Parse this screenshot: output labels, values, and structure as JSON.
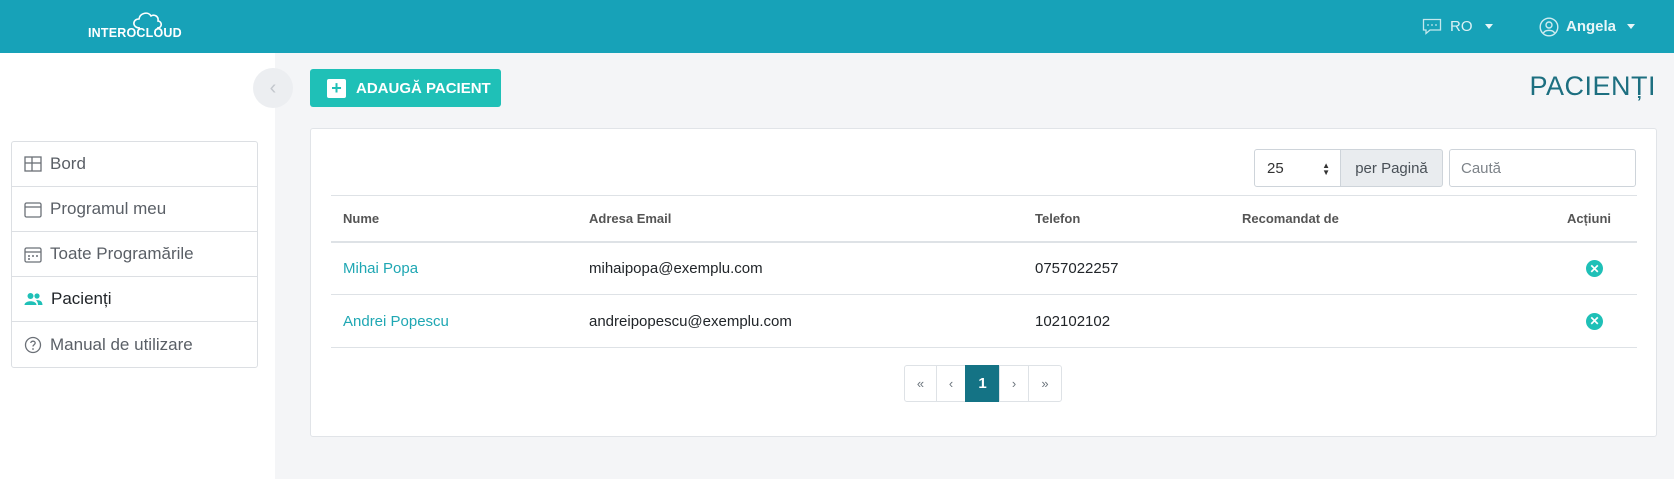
{
  "brand": {
    "logo_text": "INTEROCLOUD"
  },
  "header": {
    "language": "RO",
    "user_name": "Angela"
  },
  "sidebar": {
    "collapse_glyph": "‹",
    "items": [
      {
        "label": "Bord",
        "icon": "layout-icon",
        "active": false
      },
      {
        "label": "Programul meu",
        "icon": "calendar-icon",
        "active": false
      },
      {
        "label": "Toate Programările",
        "icon": "calendar-events-icon",
        "active": false
      },
      {
        "label": "Pacienți",
        "icon": "users-icon",
        "active": true
      },
      {
        "label": "Manual de utilizare",
        "icon": "help-circle-icon",
        "active": false
      }
    ]
  },
  "main": {
    "add_button_label": "ADAUGĂ PACIENT",
    "page_title": "PACIENȚI",
    "per_page": {
      "value": "25",
      "label": "per Pagină"
    },
    "search": {
      "placeholder": "Caută",
      "value": ""
    },
    "table": {
      "columns": [
        "Nume",
        "Adresa Email",
        "Telefon",
        "Recomandat de",
        "Acțiuni"
      ],
      "rows": [
        {
          "name": "Mihai Popa",
          "email": "mihaipopa@exemplu.com",
          "phone": "0757022257",
          "referred_by": ""
        },
        {
          "name": "Andrei Popescu",
          "email": "andreipopescu@exemplu.com",
          "phone": "102102102",
          "referred_by": ""
        }
      ]
    },
    "pagination": {
      "first": "«",
      "prev": "‹",
      "current": "1",
      "next": "›",
      "last": "»"
    }
  },
  "colors": {
    "topbar": "#17a2b8",
    "accent": "#1fc0b7",
    "title": "#1d6f80",
    "pager_active": "#147385"
  }
}
